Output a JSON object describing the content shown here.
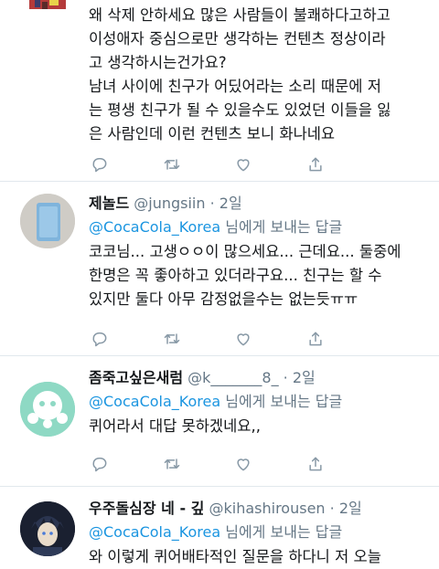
{
  "tweets": [
    {
      "body": "왜 삭제 안하세요 많은 사람들이 불쾌하다고하고\n이성애자 중심으로만 생각하는 컨텐츠 정상이라\n고 생각하시는건가요?\n남녀 사이에 친구가 어딨어라는 소리 때문에 저\n는 평생 친구가 될 수 있을수도 있었던 이들을 잃\n은 사람인데 이런 컨텐츠 보니 화나네요"
    },
    {
      "name": "제놀드",
      "handle": "@jungsiin · 2일",
      "reply_to": "@CocaCola_Korea",
      "reply_suffix": " 님에게 보내는 답글",
      "body": "코코님... 고생ㅇㅇ이 많으세요... 근데요... 둘중에\n한명은 꼭 좋아하고 있더라구요... 친구는 할 수\n있지만 둘다 아무 감정없을수는 없는듯ㅠㅠ"
    },
    {
      "name": "좀죽고싶은새럼",
      "handle": "@k_______8_ · 2일",
      "reply_to": "@CocaCola_Korea",
      "reply_suffix": " 님에게 보내는 답글",
      "body": "퀴어라서 대답 못하겠네요,,"
    },
    {
      "name": "우주돌심장 네 - 깊",
      "handle": "@kihashirousen · 2일",
      "reply_to": "@CocaCola_Korea",
      "reply_suffix": " 님에게 보내는 답글",
      "body": "와 이렇게 퀴어배타적인 질문을 하다니 저 오늘"
    }
  ],
  "icons": {
    "reply": "reply-icon",
    "retweet": "retweet-icon",
    "like": "heart-icon",
    "share": "share-icon"
  },
  "colors": {
    "link": "#1b95e0",
    "muted": "#657786",
    "icon": "#8899a6",
    "divider": "#e1e8ed"
  }
}
